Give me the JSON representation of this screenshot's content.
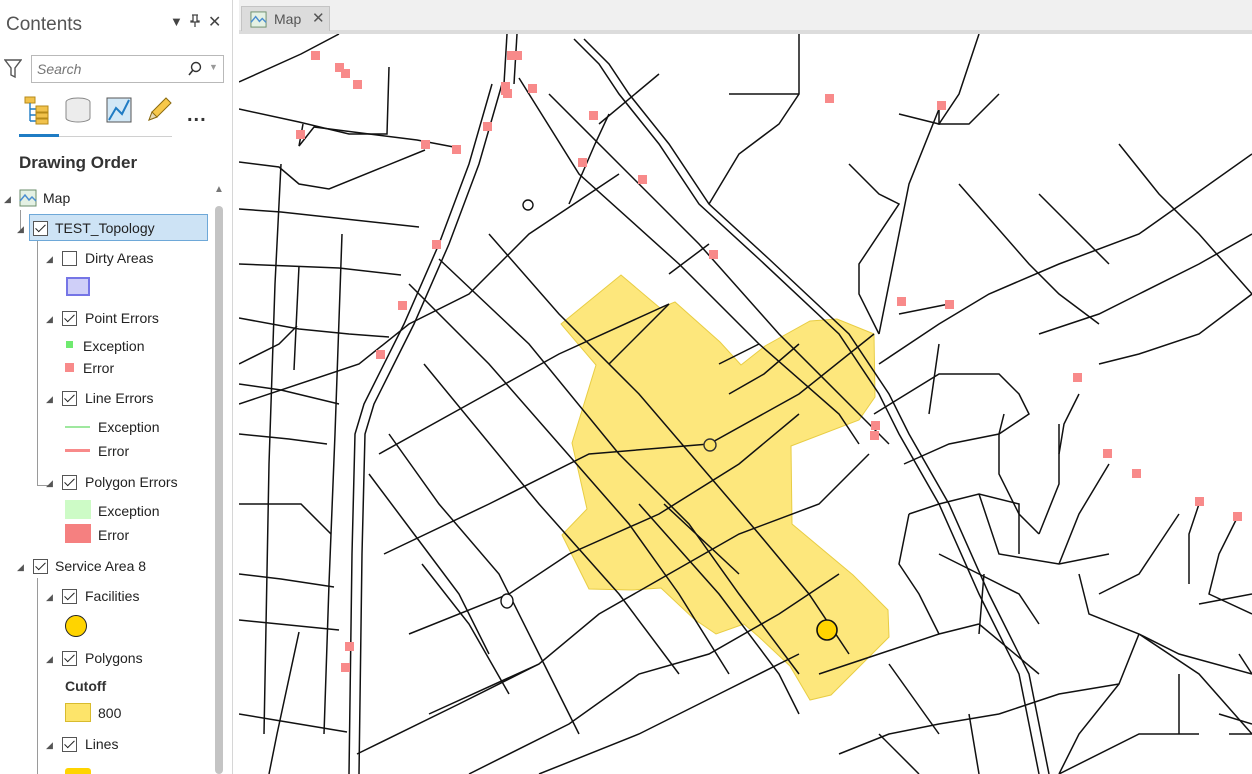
{
  "pane": {
    "title": "Contents",
    "search_placeholder": "Search",
    "more_label": "...",
    "section": "Drawing Order"
  },
  "tree": {
    "map": "Map",
    "topology": "TEST_Topology",
    "dirty_areas": "Dirty Areas",
    "point_errors": "Point Errors",
    "point_exception": "Exception",
    "point_error": "Error",
    "line_errors": "Line Errors",
    "line_exception": "Exception",
    "line_error": "Error",
    "polygon_errors": "Polygon Errors",
    "polygon_exception": "Exception",
    "polygon_error": "Error",
    "service_area": "Service Area 8",
    "facilities": "Facilities",
    "polygons": "Polygons",
    "cutoff_label": "Cutoff",
    "cutoff_value": "800",
    "lines": "Lines"
  },
  "map_tab": {
    "label": "Map",
    "close": "✕"
  },
  "colors": {
    "error": "#f88a8a",
    "exception_point": "#6fea6f",
    "exception_line": "#9fe89f",
    "polygon_exception": "#cdfbc6",
    "polygon_error": "#f58080",
    "dirty_area": "#cfcff8",
    "service_area_fill": "#fde46a",
    "facility": "#ffd400",
    "accent": "#1f7cc4"
  },
  "icons": {
    "filter": "filter-icon",
    "search": "search-icon",
    "list_by_drawing_order": "drawing-order-icon",
    "list_by_source": "database-icon",
    "list_by_selection": "selection-icon",
    "list_by_editing": "pencil-icon"
  }
}
